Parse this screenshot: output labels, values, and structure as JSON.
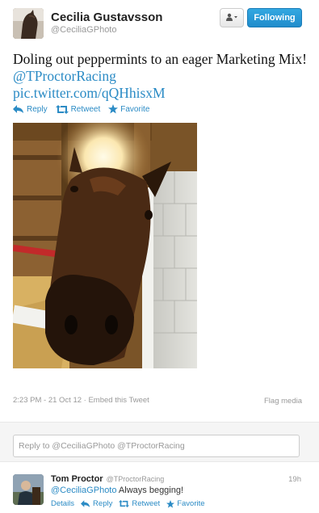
{
  "tweet": {
    "author_name": "Cecilia Gustavsson",
    "author_handle": "@CeciliaGPhoto",
    "follow_label": "Following",
    "text_plain": "Doling out peppermints to an eager Marketing Mix! ",
    "mention": "@TProctorRacing",
    "link": "pic.twitter.com/qQHhisxM",
    "actions": {
      "reply": "Reply",
      "retweet": "Retweet",
      "favorite": "Favorite"
    },
    "timestamp": "2:23 PM - 21 Oct 12",
    "separator": " · ",
    "embed_label": "Embed this Tweet",
    "flag_label": "Flag media"
  },
  "reply_box": {
    "placeholder": "Reply to @CeciliaGPhoto @TProctorRacing"
  },
  "reply": {
    "author_name": "Tom Proctor",
    "author_handle": "@TProctorRacing",
    "time": "19h",
    "mention": "@CeciliaGPhoto",
    "text": " Always begging!",
    "actions": {
      "details": "Details",
      "reply": "Reply",
      "retweet": "Retweet",
      "favorite": "Favorite"
    }
  },
  "colors": {
    "link_blue": "#2b8bc5",
    "follow_blue": "#2a9ddc",
    "muted": "#999999"
  }
}
